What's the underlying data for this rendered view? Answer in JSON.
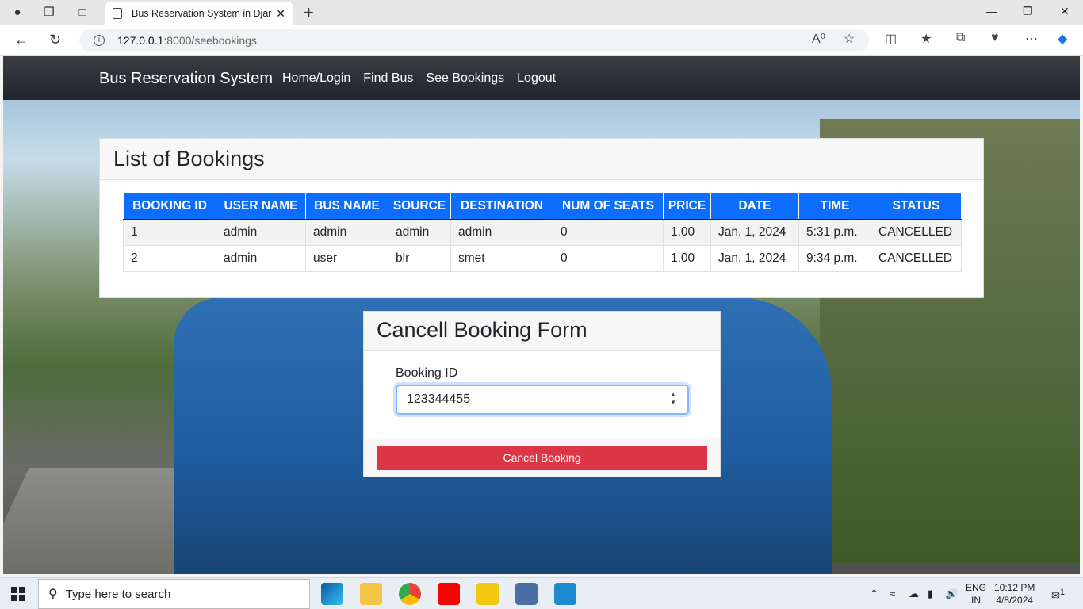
{
  "browser": {
    "tab_title": "Bus Reservation System in Djang",
    "url_host": "127.0.0.1",
    "url_rest": ":8000/seebookings"
  },
  "navbar": {
    "brand": "Bus Reservation System",
    "links": [
      "Home/Login",
      "Find Bus",
      "See Bookings",
      "Logout"
    ]
  },
  "bookings": {
    "heading": "List of Bookings",
    "columns": [
      "BOOKING ID",
      "USER NAME",
      "BUS NAME",
      "SOURCE",
      "DESTINATION",
      "NUM OF SEATS",
      "PRICE",
      "DATE",
      "TIME",
      "STATUS"
    ],
    "rows": [
      [
        "1",
        "admin",
        "admin",
        "admin",
        "admin",
        "0",
        "1.00",
        "Jan. 1, 2024",
        "5:31 p.m.",
        "CANCELLED"
      ],
      [
        "2",
        "admin",
        "user",
        "blr",
        "smet",
        "0",
        "1.00",
        "Jan. 1, 2024",
        "9:34 p.m.",
        "CANCELLED"
      ]
    ]
  },
  "cancel_form": {
    "heading": "Cancell Booking Form",
    "label": "Booking ID",
    "value": "123344455",
    "button": "Cancel Booking"
  },
  "taskbar": {
    "search_placeholder": "Type here to search",
    "lang_line1": "ENG",
    "lang_line2": "IN",
    "time": "10:12 PM",
    "date": "4/8/2024",
    "notification_count": "1"
  },
  "colors": {
    "accent": "#0d6efd",
    "danger": "#dc3545",
    "navbar": "#212529"
  }
}
